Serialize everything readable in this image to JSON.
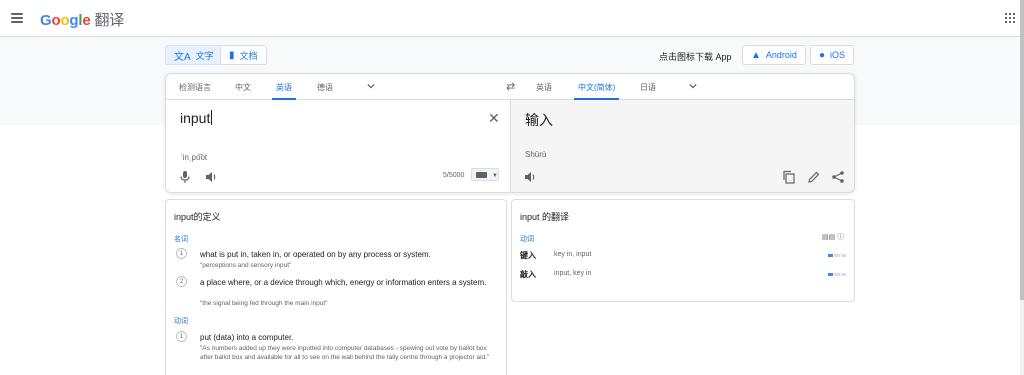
{
  "header": {
    "logo_google": "Google",
    "logo_product": "翻译",
    "brand_colors": [
      "#4285f4",
      "#ea4335",
      "#fbbc05",
      "#4285f4",
      "#34a853",
      "#ea4335"
    ]
  },
  "modes": {
    "text_label": "文字",
    "docs_label": "文档"
  },
  "download": {
    "text": "点击图标下载 App",
    "android": "Android",
    "ios": "iOS"
  },
  "source_langs": [
    "检测语言",
    "中文",
    "英语",
    "德语"
  ],
  "source_selected": "英语",
  "target_langs": [
    "英语",
    "中文(简体)",
    "日语"
  ],
  "target_selected": "中文(简体)",
  "source": {
    "text": "input",
    "transliteration": "ˈinˌpo͝ot",
    "counter": "5/5000"
  },
  "target": {
    "text": "输入",
    "pinyin": "Shūrù"
  },
  "definitions": {
    "title": "input的定义",
    "groups": [
      {
        "pos": "名词",
        "items": [
          {
            "n": "1",
            "def": "what is put in, taken in, or operated on by any process or system.",
            "ex": "\"perceptions and sensory input\""
          },
          {
            "n": "2",
            "def": "a place where, or a device through which, energy or information enters a system.",
            "ex": "\"the signal being fed through the main input\""
          }
        ]
      },
      {
        "pos": "动词",
        "items": [
          {
            "n": "1",
            "def": "put (data) into a computer.",
            "ex": "\"As numbers added up they were inputted into computer databases - spewing out vote by ballot box after ballot box and available for all to see on the wall behind the tally centre through a projector aid.\""
          }
        ]
      }
    ]
  },
  "translations": {
    "title": "input 的翻译",
    "pos": "动词",
    "rows": [
      {
        "word": "键入",
        "syn": "key in, input",
        "freq": 1
      },
      {
        "word": "敲入",
        "syn": "input, key in",
        "freq": 1
      }
    ]
  }
}
